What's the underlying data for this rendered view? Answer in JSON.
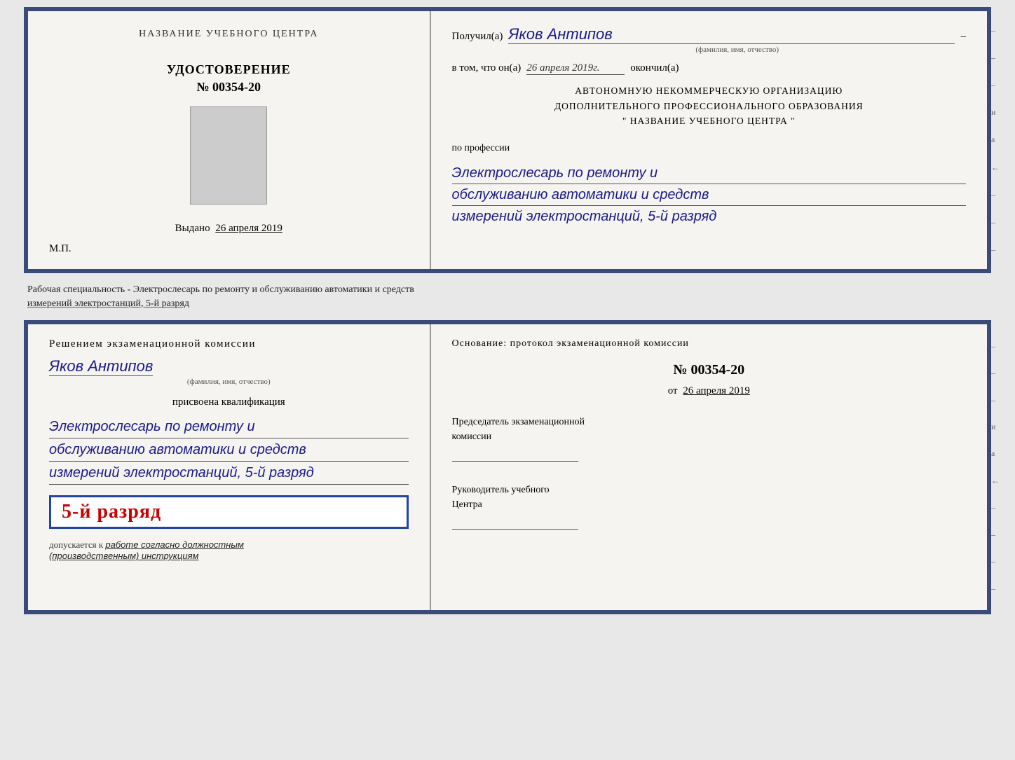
{
  "topCert": {
    "leftSide": {
      "orgNameHeader": "НАЗВАНИЕ УЧЕБНОГО ЦЕНТРА",
      "certTitle": "УДОСТОВЕРЕНИЕ",
      "certNumber": "№ 00354-20",
      "issuedLabel": "Выдано",
      "issuedDate": "26 апреля 2019",
      "mpLabel": "М.П."
    },
    "rightSide": {
      "receivedLabel": "Получил(а)",
      "recipientName": "Яков Антипов",
      "fioSubtitle": "(фамилия, имя, отчество)",
      "confirmLabel": "в том, что он(а)",
      "confirmDate": "26 апреля 2019г.",
      "finishedLabel": "окончил(а)",
      "orgLine1": "АВТОНОМНУЮ НЕКОММЕРЧЕСКУЮ ОРГАНИЗАЦИЮ",
      "orgLine2": "ДОПОЛНИТЕЛЬНОГО ПРОФЕССИОНАЛЬНОГО ОБРАЗОВАНИЯ",
      "orgLine3": "\"  НАЗВАНИЕ УЧЕБНОГО ЦЕНТРА  \"",
      "professionLabel": "по профессии",
      "profLine1": "Электрослесарь по ремонту и",
      "profLine2": "обслуживанию автоматики и средств",
      "profLine3": "измерений электростанций, 5-й разряд"
    }
  },
  "middleText": {
    "line1": "Рабочая специальность - Электрослесарь по ремонту и обслуживанию автоматики и средств",
    "line2": "измерений электростанций, 5-й разряд"
  },
  "bottomCert": {
    "leftSide": {
      "commissionTitle": "Решением экзаменационной комиссии",
      "personName": "Яков Антипов",
      "fioSubtitle": "(фамилия, имя, отчество)",
      "qualLabel": "присвоена квалификация",
      "qualLine1": "Электрослесарь по ремонту и",
      "qualLine2": "обслуживанию автоматики и средств",
      "qualLine3": "измерений электростанций, 5-й разряд",
      "rankText": "5-й разряд",
      "admitLabel": "допускается к",
      "admitText": "работе согласно должностным",
      "admitText2": "(производственным) инструкциям"
    },
    "rightSide": {
      "basisLabel": "Основание: протокол экзаменационной комиссии",
      "protocolNumber": "№  00354-20",
      "fromLabel": "от",
      "fromDate": "26 апреля 2019",
      "chairmanLabel": "Председатель экзаменационной",
      "chairmanLabel2": "комиссии",
      "directorLabel": "Руководитель учебного",
      "directorLabel2": "Центра"
    }
  },
  "sideMarks": {
    "items": [
      "-",
      "-",
      "-",
      "и",
      "а",
      "←",
      "-",
      "-",
      "-",
      "-",
      "-"
    ]
  }
}
